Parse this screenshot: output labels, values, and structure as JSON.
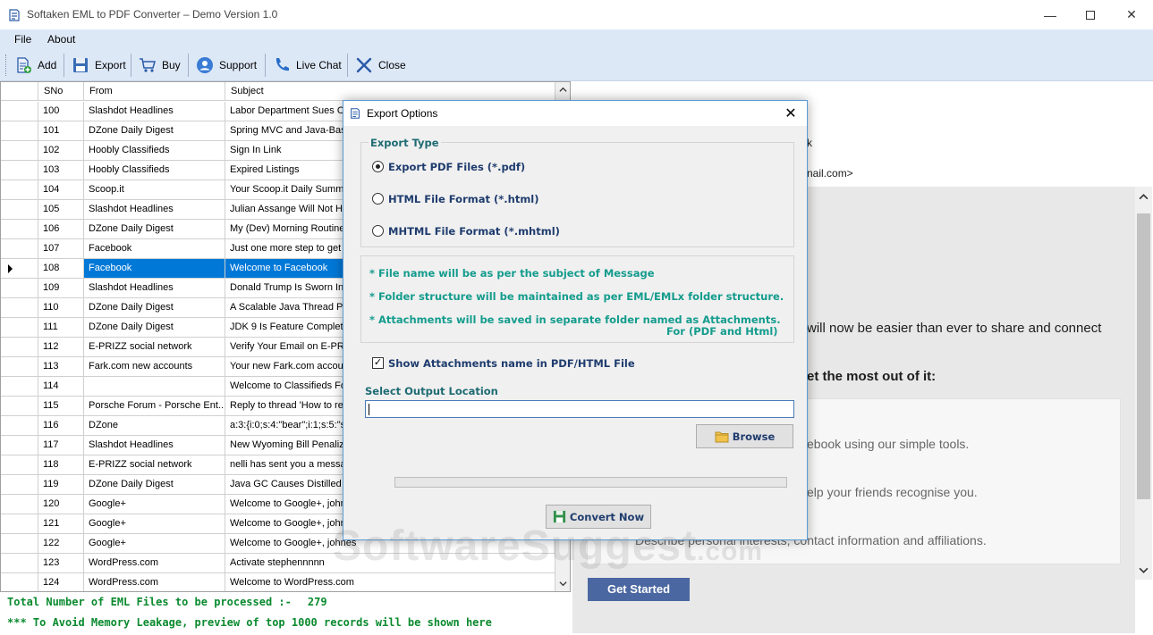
{
  "window": {
    "title": "Softaken EML to PDF Converter – Demo Version 1.0"
  },
  "menu": {
    "items": [
      "File",
      "About"
    ]
  },
  "toolbar": {
    "add": "Add",
    "export": "Export",
    "buy": "Buy",
    "support": "Support",
    "live_chat": "Live Chat",
    "close": "Close"
  },
  "grid": {
    "columns": [
      "SNo",
      "From",
      "Subject"
    ],
    "selected_sno": "108",
    "rows": [
      {
        "sno": "100",
        "from": "Slashdot Headlines",
        "subject": "Labor Department Sues Or"
      },
      {
        "sno": "101",
        "from": "DZone Daily Digest",
        "subject": "Spring MVC and Java-Base"
      },
      {
        "sno": "102",
        "from": "Hoobly Classifieds",
        "subject": "Sign In Link"
      },
      {
        "sno": "103",
        "from": "Hoobly Classifieds",
        "subject": "Expired Listings"
      },
      {
        "sno": "104",
        "from": "Scoop.it",
        "subject": "Your Scoop.it Daily Summa"
      },
      {
        "sno": "105",
        "from": "Slashdot Headlines",
        "subject": "Julian Assange Will Not Ha"
      },
      {
        "sno": "106",
        "from": "DZone Daily Digest",
        "subject": "My (Dev) Morning Routine"
      },
      {
        "sno": "107",
        "from": "Facebook",
        "subject": "Just one more step to get s"
      },
      {
        "sno": "108",
        "from": "Facebook",
        "subject": "Welcome to Facebook"
      },
      {
        "sno": "109",
        "from": "Slashdot Headlines",
        "subject": "Donald Trump Is Sworn In A"
      },
      {
        "sno": "110",
        "from": "DZone Daily Digest",
        "subject": "A Scalable Java Thread Po"
      },
      {
        "sno": "111",
        "from": "DZone Daily Digest",
        "subject": "JDK 9 Is Feature Complete"
      },
      {
        "sno": "112",
        "from": "E-PRIZZ   social network",
        "subject": "Verify Your Email on E-PRIZ"
      },
      {
        "sno": "113",
        "from": "Fark.com new accounts",
        "subject": "Your new Fark.com accoun"
      },
      {
        "sno": "114",
        "from": "",
        "subject": "Welcome to Classifieds For"
      },
      {
        "sno": "115",
        "from": "Porsche Forum - Porsche Ent...",
        "subject": "Reply to thread 'How to rep"
      },
      {
        "sno": "116",
        "from": "DZone",
        "subject": "a:3:{i:0;s:4:\"bear\";i:1;s:5:\"s"
      },
      {
        "sno": "117",
        "from": "Slashdot Headlines",
        "subject": "New Wyoming Bill Penalize"
      },
      {
        "sno": "118",
        "from": "E-PRIZZ   social network",
        "subject": "nelli has sent you a messag"
      },
      {
        "sno": "119",
        "from": "DZone Daily Digest",
        "subject": "Java GC Causes Distilled"
      },
      {
        "sno": "120",
        "from": "Google+",
        "subject": "Welcome to Google+, johne"
      },
      {
        "sno": "121",
        "from": "Google+",
        "subject": "Welcome to Google+, johne"
      },
      {
        "sno": "122",
        "from": "Google+",
        "subject": "Welcome to Google+, johnes"
      },
      {
        "sno": "123",
        "from": "WordPress.com",
        "subject": "Activate stephennnnn"
      },
      {
        "sno": "124",
        "from": "WordPress.com",
        "subject": "Welcome to WordPress.com"
      }
    ]
  },
  "status": {
    "total_label": "Total Number of EML Files to be processed :-",
    "total_count": "279",
    "memory_note": "*** To Avoid Memory Leakage, preview of top 1000 records will be shown here"
  },
  "preview": {
    "line1": "k",
    "line2": "nail.com>",
    "line3": "will now be easier than ever to share and connect",
    "line4": "et the most out of it:",
    "line5": "ebook using our simple tools.",
    "line6": "elp your friends recognise you.",
    "line7": "Describe personal interests, contact information and affiliations.",
    "button": "Get Started"
  },
  "watermark": {
    "main": "SoftwareSuggest",
    "suffix": ".com"
  },
  "dialog": {
    "title": "Export Options",
    "export_type_label": "Export Type",
    "options": [
      {
        "label": "Export PDF Files (*.pdf)",
        "selected": true
      },
      {
        "label": "HTML File  Format (*.html)",
        "selected": false
      },
      {
        "label": "MHTML File  Format (*.mhtml)",
        "selected": false
      }
    ],
    "notes": [
      "* File name will be as per the subject of Message",
      "* Folder structure will be maintained as per EML/EMLx folder structure.",
      "* Attachments will be saved in separate folder named as Attachments.",
      "For (PDF and Html)"
    ],
    "show_attachments_label": "Show Attachments name in PDF/HTML File",
    "show_attachments_checked": true,
    "output_location_label": "Select Output Location",
    "output_location_value": "",
    "browse": "Browse",
    "progress": 0,
    "convert": "Convert Now"
  },
  "colors": {
    "accent": "#0078d7",
    "dialog_text": "#1f6b73",
    "status_text": "#0a8a2e",
    "toolbar_bg": "#dde8f7"
  }
}
